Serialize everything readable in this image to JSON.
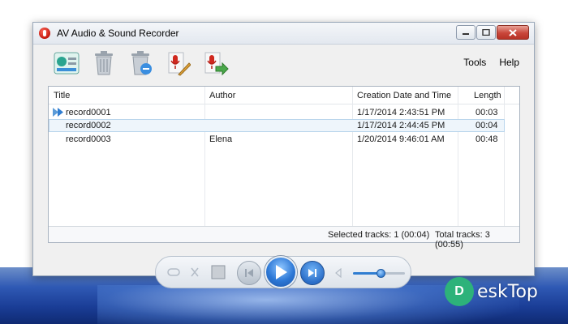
{
  "window": {
    "title": "AV Audio & Sound Recorder"
  },
  "menu": {
    "tools": "Tools",
    "help": "Help"
  },
  "toolbar": {
    "icons": [
      "new-record-icon",
      "delete-icon",
      "delete-all-icon",
      "record-edit-icon",
      "export-icon"
    ]
  },
  "list": {
    "columns": {
      "title": "Title",
      "author": "Author",
      "date": "Creation Date and Time",
      "length": "Length"
    },
    "rows": [
      {
        "title": "record0001",
        "author": "",
        "date": "1/17/2014 2:43:51 PM",
        "length": "00:03",
        "playing": true,
        "selected": false
      },
      {
        "title": "record0002",
        "author": "",
        "date": "1/17/2014 2:44:45 PM",
        "length": "00:04",
        "playing": false,
        "selected": true
      },
      {
        "title": "record0003",
        "author": "Elena",
        "date": "1/20/2014 9:46:01 AM",
        "length": "00:48",
        "playing": false,
        "selected": false
      }
    ]
  },
  "status": {
    "selected": "Selected tracks: 1 (00:04)",
    "total": "Total tracks: 3 (00:55)"
  },
  "player": {
    "volume": 0.53
  },
  "watermark": {
    "text": "eskTop"
  },
  "colors": {
    "accent": "#2f7dd1",
    "record_red": "#c3170c",
    "selection": "#eef5fb"
  }
}
